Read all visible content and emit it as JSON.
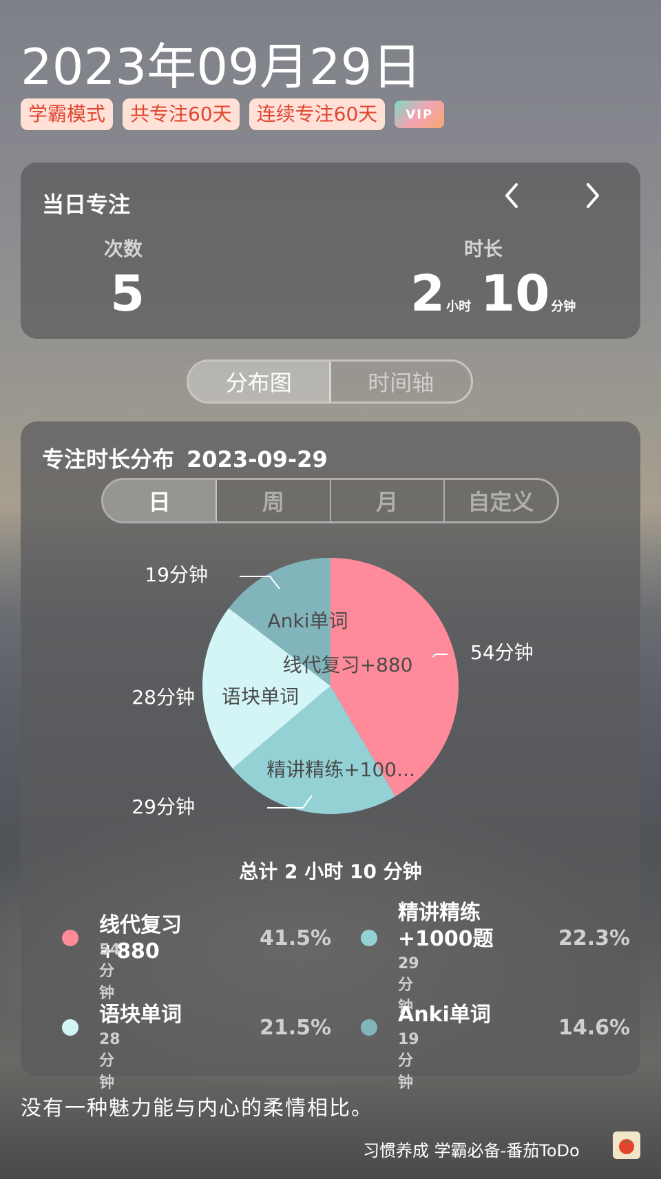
{
  "date": "2023年09月29日",
  "badges": [
    "学霸模式",
    "共专注60天",
    "连续专注60天"
  ],
  "vip_label": "VIP",
  "daily": {
    "title": "当日专注",
    "count_label": "次数",
    "count_value": "5",
    "duration_label": "时长",
    "hours": "2",
    "hours_unit": "小时",
    "minutes": "10",
    "minutes_unit": "分钟"
  },
  "view_tabs": [
    "分布图",
    "时间轴"
  ],
  "distribution": {
    "title": "专注时长分布",
    "date": "2023-09-29",
    "range_tabs": [
      "日",
      "周",
      "月",
      "自定义"
    ],
    "total": "总计 2 小时 10 分钟"
  },
  "chart_data": {
    "type": "pie",
    "slices": [
      {
        "name": "线代复习+880",
        "inner_label": "线代复习+880",
        "value": 54,
        "value_label": "54分钟",
        "percent": "41.5%",
        "color": "#ff8a99"
      },
      {
        "name": "精讲精练+1000题",
        "inner_label": "精讲精练+100...",
        "value": 29,
        "value_label": "29分钟",
        "percent": "22.3%",
        "color": "#94d1d5"
      },
      {
        "name": "语块单词",
        "inner_label": "语块单词",
        "value": 28,
        "value_label": "28分钟",
        "percent": "21.5%",
        "color": "#d3f5f6"
      },
      {
        "name": "Anki单词",
        "inner_label": "Anki单词",
        "value": 19,
        "value_label": "19分钟",
        "percent": "14.6%",
        "color": "#82b4bc"
      }
    ]
  },
  "legend": [
    {
      "name": "线代复习+880",
      "sub": "54分钟",
      "percent": "41.5%"
    },
    {
      "name": "精讲精练+1000题",
      "sub": "29分钟",
      "percent": "22.3%"
    },
    {
      "name": "语块单词",
      "sub": "28分钟",
      "percent": "21.5%"
    },
    {
      "name": "Anki单词",
      "sub": "19分钟",
      "percent": "14.6%"
    }
  ],
  "quote": "没有一种魅力能与内心的柔情相比。",
  "brand": "习惯养成 学霸必备-番茄ToDo",
  "icons": {
    "prev": "chevron-left-icon",
    "next": "chevron-right-icon",
    "app": "tomato-icon"
  }
}
